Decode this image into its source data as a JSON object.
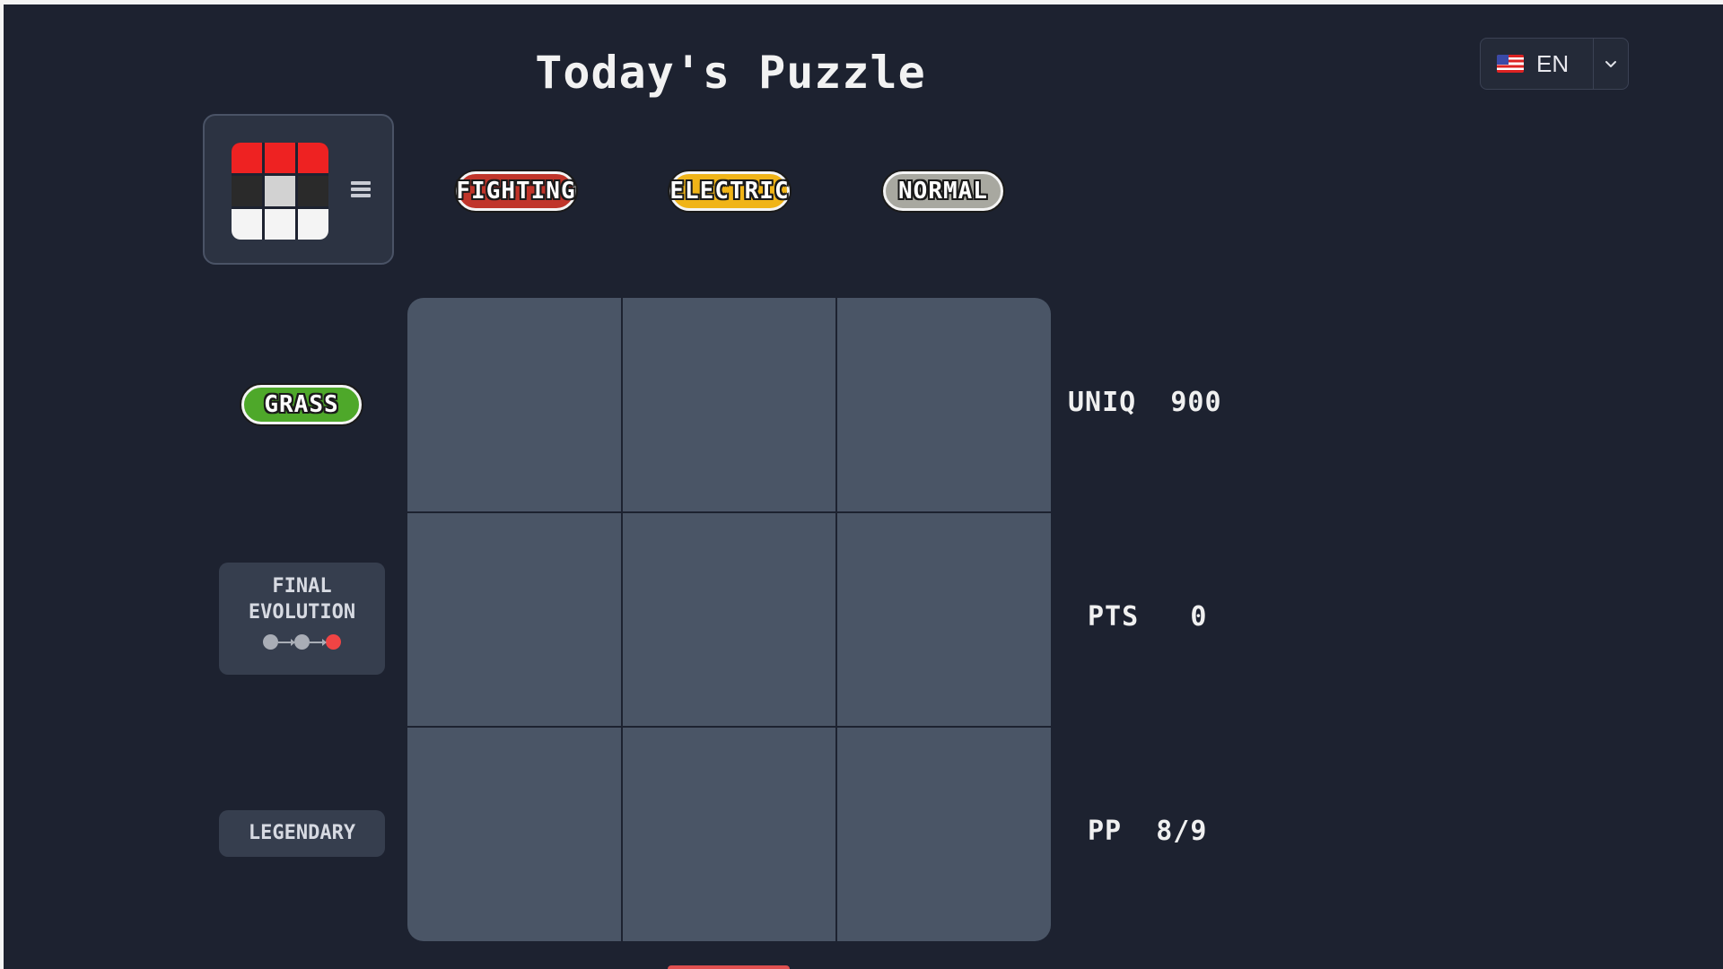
{
  "page": {
    "title": "Today's Puzzle"
  },
  "language": {
    "label": "EN",
    "flag_icon": "us-flag-icon"
  },
  "logo": {
    "menu_icon": "hamburger-menu-icon"
  },
  "columns": [
    {
      "label": "FIGHTING",
      "color": "#c0352a"
    },
    {
      "label": "ELECTRIC",
      "color": "#f0b418"
    },
    {
      "label": "NORMAL",
      "color": "#a8a8a0"
    }
  ],
  "rows": [
    {
      "label": "GRASS",
      "color": "#4ea82a"
    },
    {
      "line1": "FINAL",
      "line2": "EVOLUTION"
    },
    {
      "label": "LEGENDARY"
    }
  ],
  "stats": {
    "uniq_label": "UNIQ",
    "uniq_value": "900",
    "pts_label": "PTS",
    "pts_value": "0",
    "pp_label": "PP",
    "pp_value": "8/9"
  },
  "colors": {
    "background": "#1d2230",
    "cell": "#4a5566",
    "accent_red": "#ee2222"
  }
}
